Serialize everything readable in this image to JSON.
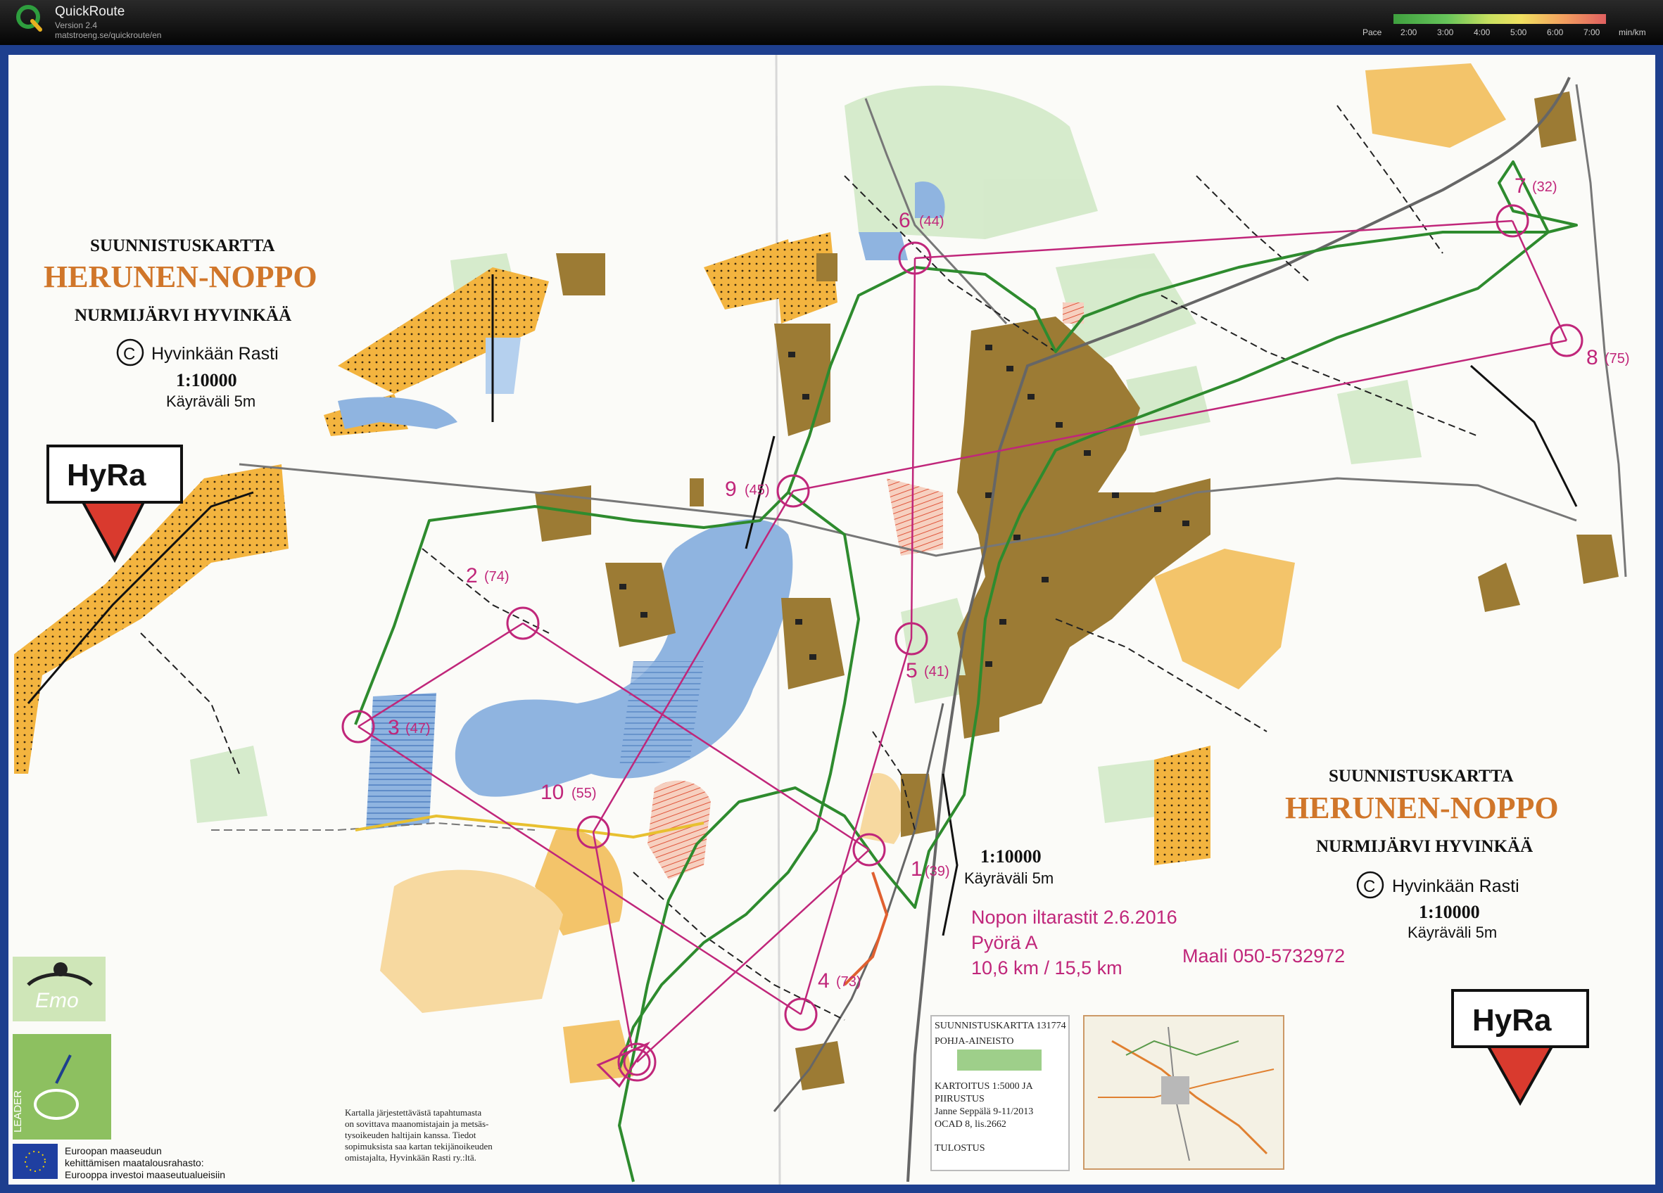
{
  "app": {
    "title": "QuickRoute",
    "version": "Version 2.4",
    "url": "matstroeng.se/quickroute/en"
  },
  "pace_legend": {
    "label": "Pace",
    "ticks": [
      "2:00",
      "3:00",
      "4:00",
      "5:00",
      "6:00",
      "7:00"
    ],
    "unit": "min/km"
  },
  "map": {
    "title_left": {
      "line1": "SUUNNISTUSKARTTA",
      "line2": "HERUNEN-NOPPO",
      "line3": "NURMIJÄRVI HYVINKÄÄ",
      "copyright": "Hyvinkään Rasti",
      "scale": "1:10000",
      "contour": "Käyräväli 5m"
    },
    "title_right": {
      "line1": "SUUNNISTUSKARTTA",
      "line2": "HERUNEN-NOPPO",
      "line3": "NURMIJÄRVI HYVINKÄÄ",
      "copyright": "Hyvinkään Rasti",
      "scale": "1:10000",
      "contour": "Käyräväli 5m"
    },
    "center_scale": {
      "scale": "1:10000",
      "contour": "Käyräväli 5m"
    },
    "logo_text": "HyRa",
    "copyright_symbol": "C",
    "event": {
      "line1": "Nopon iltarastit 2.6.2016",
      "line2": "Pyörä A",
      "line3": "10,6 km / 15,5 km",
      "finish": "Maali 050-5732972"
    },
    "controls": [
      {
        "num": "1",
        "code": "(39)"
      },
      {
        "num": "2",
        "code": "(74)"
      },
      {
        "num": "3",
        "code": "(47)"
      },
      {
        "num": "4",
        "code": "(73)"
      },
      {
        "num": "5",
        "code": "(41)"
      },
      {
        "num": "6",
        "code": "(44)"
      },
      {
        "num": "7",
        "code": "(32)"
      },
      {
        "num": "8",
        "code": "(75)"
      },
      {
        "num": "9",
        "code": "(45)"
      },
      {
        "num": "10",
        "code": "(55)"
      }
    ],
    "disclaimer": [
      "Kartalla järjestettävästä tapahtumasta",
      "on sovittava maanomistajain ja metsäs-",
      "tysoikeuden haltijain kanssa. Tiedot",
      "sopimuksista saa kartan tekijänoikeuden",
      "omistajalta, Hyvinkään Rasti ry.:ltä."
    ],
    "credits": [
      "SUUNNISTUSKARTTA 131774",
      "POHJA-AINEISTO",
      "KARTOITUS 1:5000 JA",
      "PIIRUSTUS",
      "Janne Seppälä 9-11/2013",
      "OCAD 8, lis.2662",
      "TULOSTUS"
    ],
    "eu_text": [
      "Euroopan maaseudun",
      "kehittämisen maatalousrahasto:",
      "Eurooppa investoi maaseutualueisiin"
    ],
    "leader_text": "LEADER",
    "colors": {
      "course": "#c0267a",
      "route": "#2e8b2e",
      "water": "#8fb4e0",
      "open": "#f3b43f",
      "building": "#8b6a2b",
      "frame": "#1e3f8e"
    }
  }
}
